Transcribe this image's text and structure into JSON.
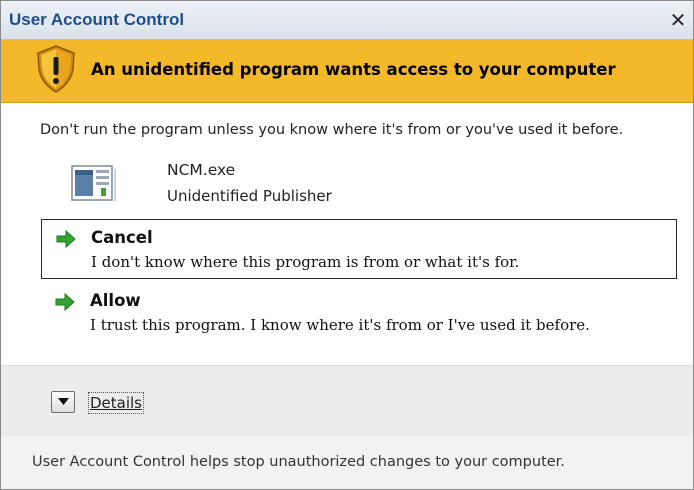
{
  "window": {
    "title": "User Account Control",
    "close_glyph": "✕"
  },
  "banner": {
    "icon": "warning-shield-icon",
    "text": "An unidentified program wants access to your computer",
    "color": "#f4b92a"
  },
  "warning": {
    "text": "Don't run the program unless you know where it's from or you've used it before."
  },
  "program": {
    "icon": "program-icon",
    "name": "NCM.exe",
    "publisher": "Unidentified Publisher"
  },
  "options": [
    {
      "icon": "green-arrow-icon",
      "title": "Cancel",
      "description": "I don't know where this program is from or what it's for."
    },
    {
      "icon": "green-arrow-icon",
      "title": "Allow",
      "description": "I trust this program. I know where it's from or I've used it before."
    }
  ],
  "details": {
    "icon": "chevron-down-icon",
    "label": "Details"
  },
  "footer": {
    "text": "User Account Control helps stop unauthorized changes to your computer."
  }
}
